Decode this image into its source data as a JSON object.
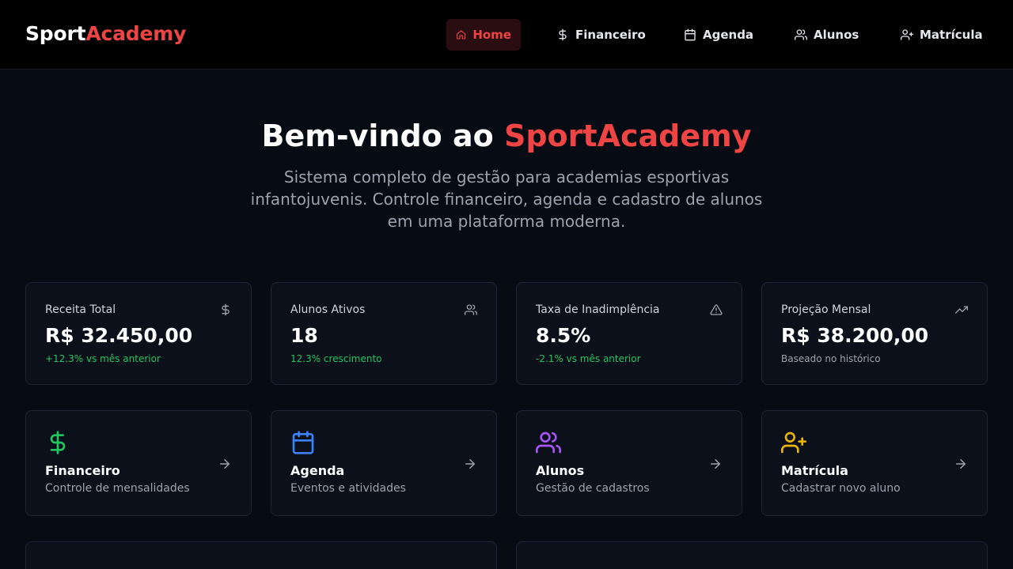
{
  "brand": {
    "part1": "Sport",
    "part2": "Academy"
  },
  "nav": [
    {
      "label": "Home",
      "icon": "home-icon",
      "active": true
    },
    {
      "label": "Financeiro",
      "icon": "dollar-icon"
    },
    {
      "label": "Agenda",
      "icon": "calendar-icon"
    },
    {
      "label": "Alunos",
      "icon": "users-icon"
    },
    {
      "label": "Matrícula",
      "icon": "user-plus-icon"
    }
  ],
  "hero": {
    "title_prefix": "Bem-vindo ao ",
    "title_accent": "SportAcademy",
    "subtitle": "Sistema completo de gestão para academias esportivas infantojuvenis. Controle financeiro, agenda e cadastro de alunos em uma plataforma moderna."
  },
  "stats": [
    {
      "label": "Receita Total",
      "value": "R$ 32.450,00",
      "note": "+12.3% vs mês anterior",
      "icon": "dollar-icon",
      "note_color": "#22c55e"
    },
    {
      "label": "Alunos Ativos",
      "value": "18",
      "note": "12.3% crescimento",
      "icon": "users-icon",
      "note_color": "#22c55e"
    },
    {
      "label": "Taxa de Inadimplência",
      "value": "8.5%",
      "note": "-2.1% vs mês anterior",
      "icon": "alert-triangle-icon",
      "note_color": "#22c55e"
    },
    {
      "label": "Projeção Mensal",
      "value": "R$ 38.200,00",
      "note": "Baseado no histórico",
      "icon": "trending-up-icon",
      "note_color": "#9ca3af"
    }
  ],
  "features": [
    {
      "title": "Financeiro",
      "desc": "Controle de mensalidades",
      "icon": "dollar-icon",
      "color": "#22c55e"
    },
    {
      "title": "Agenda",
      "desc": "Eventos e atividades",
      "icon": "calendar-icon",
      "color": "#3b82f6"
    },
    {
      "title": "Alunos",
      "desc": "Gestão de cadastros",
      "icon": "users-icon",
      "color": "#a855f7"
    },
    {
      "title": "Matrícula",
      "desc": "Cadastrar novo aluno",
      "icon": "user-plus-icon",
      "color": "#eab308"
    }
  ],
  "colors": {
    "accent": "#ef4444",
    "background": "#070b14",
    "card": "#0b101b"
  }
}
